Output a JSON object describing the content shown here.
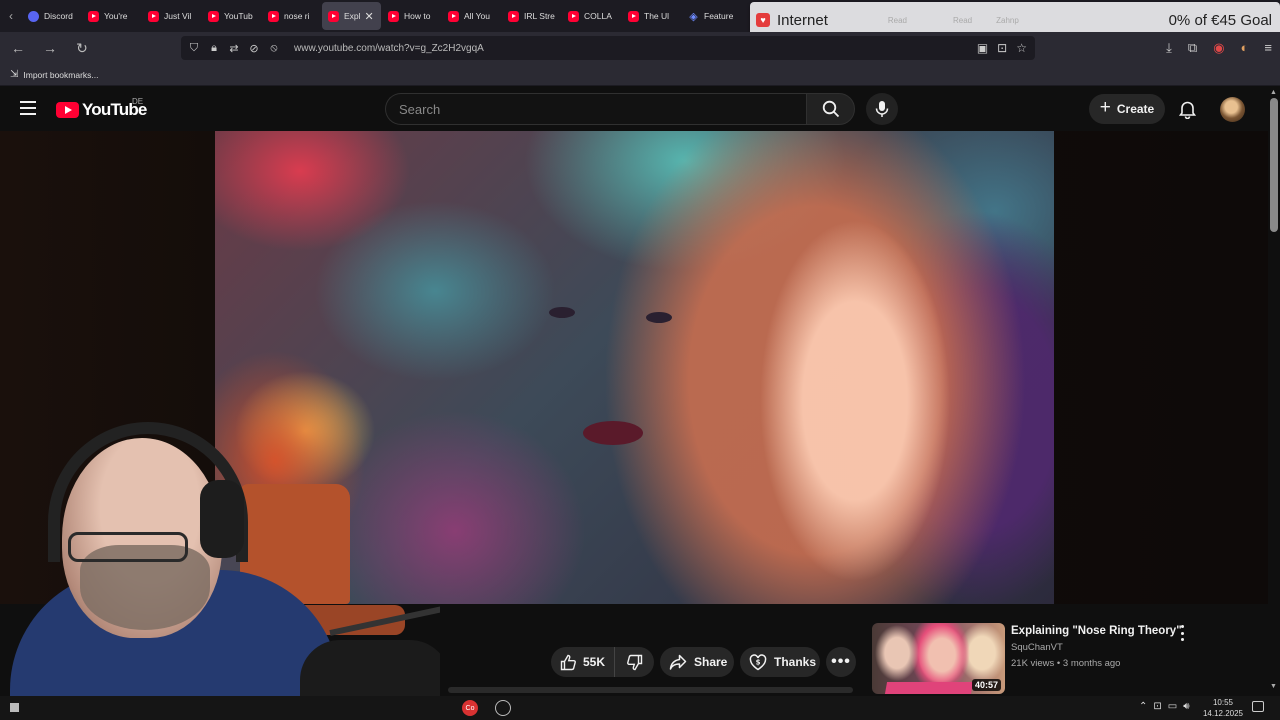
{
  "browser": {
    "tabs": [
      {
        "label": "Discord",
        "fav": "dc"
      },
      {
        "label": "You're",
        "fav": "yt"
      },
      {
        "label": "Just Vil",
        "fav": "yt"
      },
      {
        "label": "YouTub",
        "fav": "yt"
      },
      {
        "label": "nose ri",
        "fav": "yt"
      },
      {
        "label": "Expl",
        "fav": "yt",
        "active": true
      },
      {
        "label": "How to",
        "fav": "yt"
      },
      {
        "label": "All You",
        "fav": "yt"
      },
      {
        "label": "IRL Stre",
        "fav": "yt"
      },
      {
        "label": "COLLA",
        "fav": "yt"
      },
      {
        "label": "The Ul",
        "fav": "yt"
      },
      {
        "label": "Feature",
        "fav": "ft"
      }
    ],
    "url": "www.youtube.com/watch?v=g_Zc2H2vgqA",
    "bookmarks_label": "Import bookmarks..."
  },
  "overlay": {
    "title": "Internet",
    "ghost_1": "Read",
    "ghost_2": "Read",
    "ghost_3": "Zahnp",
    "goal": "0% of €45 Goal"
  },
  "youtube": {
    "logo_text": "YouTube",
    "country": "DE",
    "search_placeholder": "Search",
    "create_label": "Create"
  },
  "actions": {
    "likes": "55K",
    "share_label": "Share",
    "thanks_label": "Thanks"
  },
  "recommendation": {
    "title": "Explaining \"Nose Ring Theory\"",
    "channel": "SquChanVT",
    "meta": "21K views • 3 months ago",
    "duration": "40:57"
  },
  "taskbar": {
    "time": "10:55",
    "date": "14.12.2025"
  },
  "colors": {
    "youtube_red": "#ff0033",
    "page_bg": "#0f0f0f",
    "pill_bg": "#272727"
  }
}
